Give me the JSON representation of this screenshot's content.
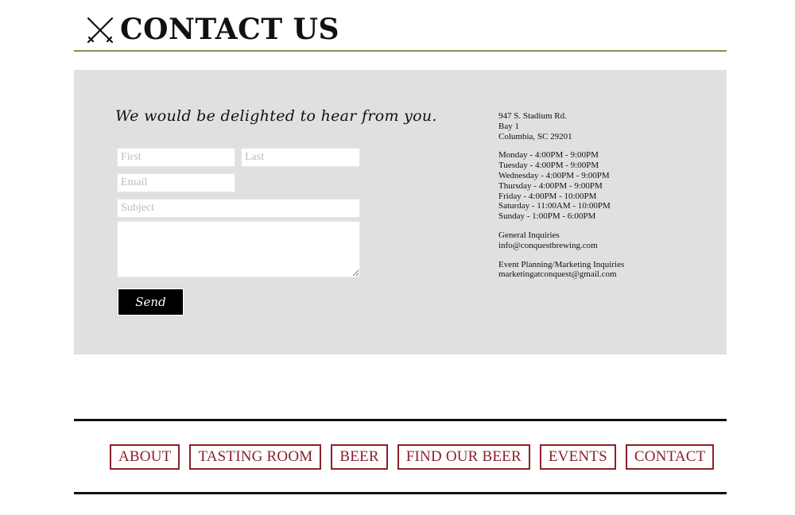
{
  "header": {
    "title": "CONTACT US",
    "logo_icon": "crossed-swords-icon"
  },
  "contact_form": {
    "tagline": "We would be delighted to hear from you.",
    "first_placeholder": "First",
    "last_placeholder": "Last",
    "email_placeholder": "Email",
    "subject_placeholder": "Subject",
    "message_placeholder": "",
    "send_label": "Send"
  },
  "info": {
    "address": [
      "947 S. Stadium Rd.",
      "Bay 1",
      "Columbia, SC 29201"
    ],
    "hours": [
      "Monday - 4:00PM - 9:00PM",
      "Tuesday - 4:00PM - 9:00PM",
      "Wednesday - 4:00PM - 9:00PM",
      "Thursday - 4:00PM - 9:00PM",
      "Friday - 4:00PM - 10:00PM",
      "Saturday - 11:00AM - 10:00PM",
      "Sunday - 1:00PM - 6:00PM"
    ],
    "general": [
      "General Inquiries",
      "info@conquestbrewing.com"
    ],
    "events": [
      "Event Planning/Marketing Inquiries",
      "marketingatconquest@gmail.com"
    ]
  },
  "footer_nav": {
    "items": [
      "ABOUT",
      "TASTING ROOM",
      "BEER",
      "FIND OUR BEER",
      "EVENTS",
      "CONTACT"
    ]
  },
  "colors": {
    "accent_olive": "#8a8c58",
    "nav_red": "#8b2129",
    "panel_gray": "#e0e0e0"
  }
}
